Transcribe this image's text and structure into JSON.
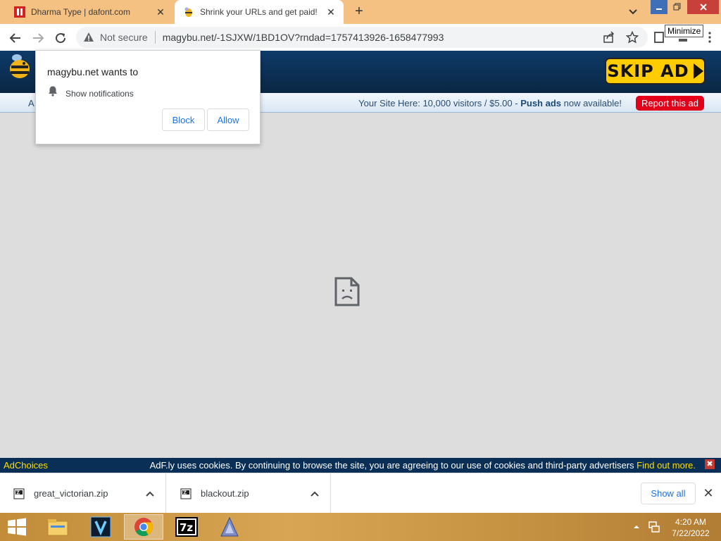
{
  "browser": {
    "tabs": [
      {
        "title": "Dharma Type | dafont.com",
        "active": false
      },
      {
        "title": "Shrink your URLs and get paid!",
        "active": true
      }
    ],
    "new_tab_label": "+",
    "address": {
      "security_label": "Not secure",
      "url": "magybu.net/-1SJXW/1BD1OV?rndad=1757413926-1658477993"
    },
    "tooltip": "Minimize"
  },
  "page": {
    "skip_ad_label": "SKIP AD",
    "subbar_left_fragment": "A",
    "promo": {
      "prefix": "Your Site Here: 10,000 visitors / $5.00 - ",
      "bold": "Push ads",
      "suffix": " now available!"
    },
    "report_label": "Report this ad",
    "error_icon": "sad-file-icon"
  },
  "notification_popup": {
    "title": "magybu.net wants to",
    "permission": "Show notifications",
    "block_label": "Block",
    "allow_label": "Allow"
  },
  "cookie_bar": {
    "adchoices": "AdChoices",
    "message": "AdF.ly uses cookies. By continuing to browse the site, you are agreeing to our use of cookies and third-party advertisers ",
    "link": "Find out more.",
    "close": "✖"
  },
  "downloads": {
    "items": [
      {
        "name": "great_victorian.zip"
      },
      {
        "name": "blackout.zip"
      }
    ],
    "show_all_label": "Show all"
  },
  "taskbar": {
    "apps": [
      "start-button",
      "file-explorer",
      "vegas",
      "chrome",
      "7zip",
      "font-app"
    ],
    "clock_time": "4:20 AM",
    "clock_date": "7/22/2022"
  },
  "colors": {
    "accent": "#1a73e8",
    "header_bg": "#0e3a68",
    "skip": "#ffcc00",
    "report": "#e2001a",
    "tab_strip": "#f4c182"
  }
}
